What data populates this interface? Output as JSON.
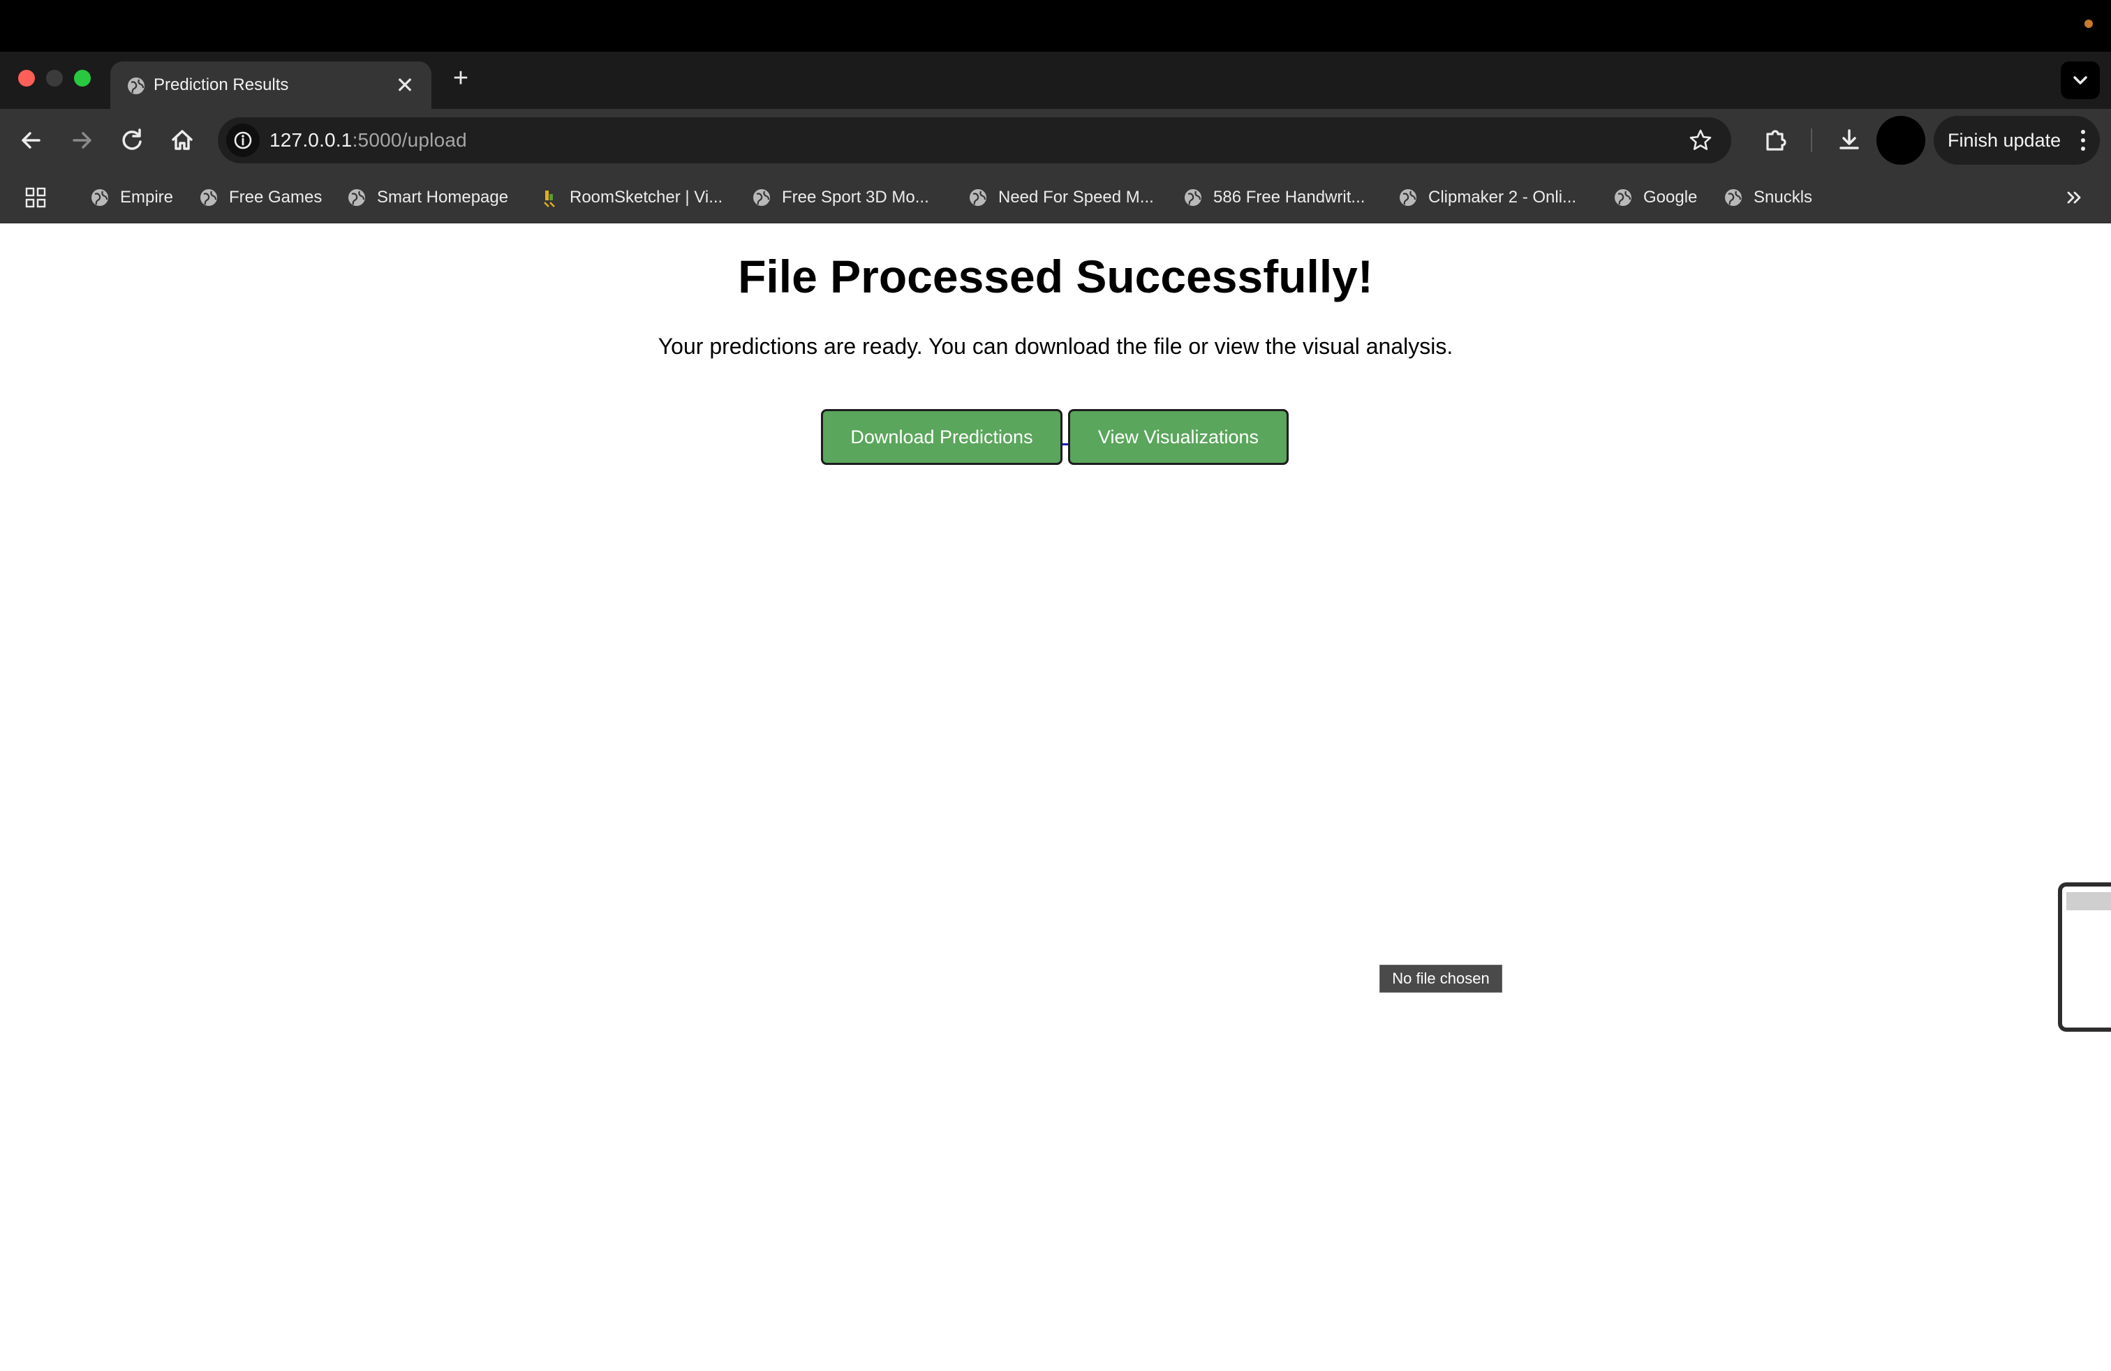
{
  "browser": {
    "tab": {
      "title": "Prediction Results",
      "close_glyph": "✕"
    },
    "new_tab_glyph": "+",
    "address": {
      "host": "127.0.0.1",
      "path": ":5000/upload"
    },
    "finish_update_label": "Finish update",
    "bookmarks": [
      {
        "label": "Empire",
        "icon": "globe-icon"
      },
      {
        "label": "Free Games",
        "icon": "globe-icon"
      },
      {
        "label": "Smart Homepage",
        "icon": "globe-icon"
      },
      {
        "label": "RoomSketcher | Vi...",
        "icon": "roomsketcher-icon"
      },
      {
        "label": "Free Sport 3D Mo...",
        "icon": "globe-icon"
      },
      {
        "label": "Need For Speed M...",
        "icon": "globe-icon"
      },
      {
        "label": "586 Free Handwrit...",
        "icon": "globe-icon"
      },
      {
        "label": "Clipmaker 2 - Onli...",
        "icon": "globe-icon"
      },
      {
        "label": "Google",
        "icon": "globe-icon"
      },
      {
        "label": "Snuckls",
        "icon": "globe-icon"
      }
    ]
  },
  "page": {
    "heading": "File Processed Successfully!",
    "subtext": "Your predictions are ready. You can download the file or view the visual analysis.",
    "download_button": "Download Predictions",
    "visualize_button": "View Visualizations",
    "tooltip": "No file chosen"
  },
  "colors": {
    "button_green": "#5aa65c",
    "window_red": "#fe5f57",
    "window_green": "#28c840"
  }
}
